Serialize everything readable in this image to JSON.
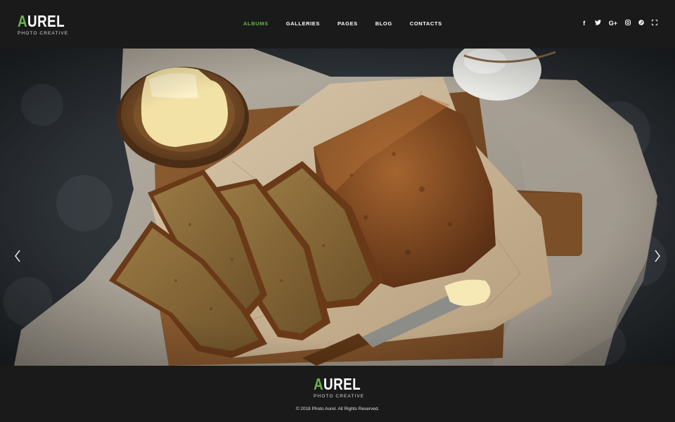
{
  "brand": {
    "first_letter": "A",
    "rest": "UREL",
    "tagline": "PHOTO CREATIVE",
    "accent_color": "#6bb44a"
  },
  "nav": {
    "items": [
      {
        "label": "ALBUMS",
        "active": true
      },
      {
        "label": "GALLERIES",
        "active": false
      },
      {
        "label": "PAGES",
        "active": false
      },
      {
        "label": "BLOG",
        "active": false
      },
      {
        "label": "CONTACTS",
        "active": false
      }
    ]
  },
  "social": {
    "icons": [
      {
        "name": "facebook-icon",
        "glyph": "f"
      },
      {
        "name": "twitter-icon",
        "glyph": "t"
      },
      {
        "name": "google-plus-icon",
        "glyph": "G+"
      },
      {
        "name": "instagram-icon",
        "glyph": "◎"
      },
      {
        "name": "pinterest-icon",
        "glyph": "℗"
      },
      {
        "name": "fullscreen-icon",
        "glyph": "⛶"
      }
    ]
  },
  "slider": {
    "prev_icon": "chevron-left-icon",
    "next_icon": "chevron-right-icon"
  },
  "footer": {
    "first_letter": "A",
    "rest": "UREL",
    "tagline": "PHOTO CREATIVE",
    "copyright": "© 2018 Photo Aurel. All Rights Reserved."
  }
}
